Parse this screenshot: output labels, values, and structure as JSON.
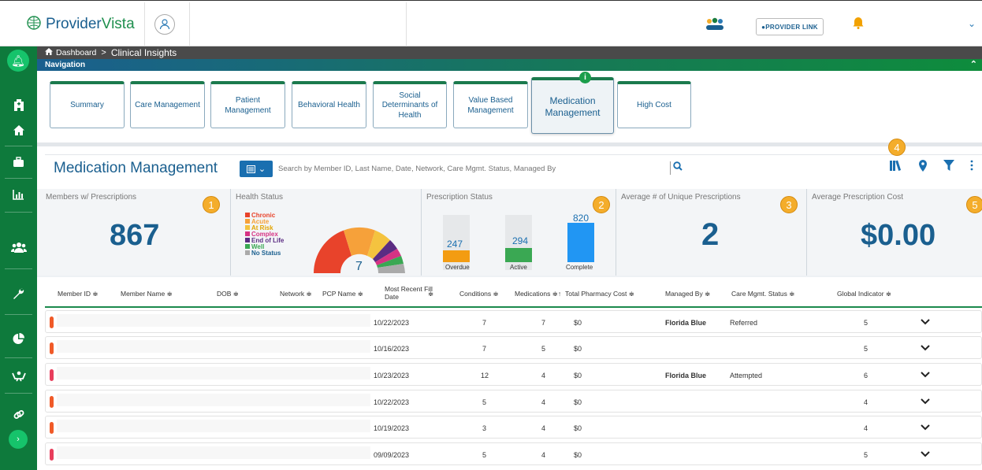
{
  "app": {
    "logo_text_a": "Provider",
    "logo_text_b": "Vista",
    "provider_link_label": "PROVIDER LINK"
  },
  "breadcrumb": {
    "home_icon": "home-icon",
    "root": "Dashboard",
    "sep": ">",
    "current": "Clinical Insights"
  },
  "navigation": {
    "label": "Navigation"
  },
  "tabs": [
    {
      "label": "Summary"
    },
    {
      "label": "Care Management"
    },
    {
      "label": "Patient Management"
    },
    {
      "label": "Behavioral Health"
    },
    {
      "label": "Social Determinants of Health"
    },
    {
      "label": "Value Based Management"
    },
    {
      "label": "Medication Management"
    },
    {
      "label": "High Cost"
    }
  ],
  "active_tab": "Medication Management",
  "page": {
    "title": "Medication Management",
    "search_placeholder": "Search by Member ID, Last Name, Date, Network, Care Mgmt. Status, Managed By"
  },
  "badges": [
    "1",
    "2",
    "3",
    "4",
    "5"
  ],
  "cards": {
    "members": {
      "title": "Members w/ Prescriptions",
      "value": "867"
    },
    "health": {
      "title": "Health Status",
      "legend": [
        {
          "label": "Chronic",
          "color": "#e8432b"
        },
        {
          "label": "Acute",
          "color": "#f6a13a"
        },
        {
          "label": "At Risk",
          "color": "#f4c33f"
        },
        {
          "label": "Complex",
          "color": "#d63384"
        },
        {
          "label": "End of Life",
          "color": "#5b2c83"
        },
        {
          "label": "Well",
          "color": "#3aa853"
        },
        {
          "label": "No Status",
          "color": "#aaaaaa"
        }
      ],
      "center_value": "7"
    },
    "prescription": {
      "title": "Prescription Status",
      "bars": [
        {
          "label": "Overdue",
          "value": "247",
          "color": "#f39c12"
        },
        {
          "label": "Active",
          "value": "294",
          "color": "#3aa853"
        },
        {
          "label": "Complete",
          "value": "820",
          "color": "#2196f3"
        }
      ]
    },
    "unique": {
      "title": "Average # of Unique Prescriptions",
      "value": "2"
    },
    "cost": {
      "title": "Average Prescription Cost",
      "value": "$0.00"
    }
  },
  "table": {
    "headers": {
      "member_id": "Member ID ≑",
      "member_name": "Member Name ≑",
      "dob": "DOB ≑",
      "network": "Network ≑",
      "pcp": "PCP Name ≑",
      "fill_date_a": "Most Recent Fill",
      "fill_date_b": "Date",
      "fill_sort": "≑",
      "conditions": "Conditions ≑",
      "medications": "Medications ≑↑",
      "cost": "Total Pharmacy Cost ≑",
      "managed_by": "Managed By ≑",
      "status": "Care Mgmt. Status ≑",
      "global": "Global Indicator ≑"
    },
    "rows": [
      {
        "fill_date": "10/22/2023",
        "conditions": "7",
        "medications": "7",
        "cost": "$0",
        "managed_by": "Florida Blue",
        "status": "Referred",
        "global": "5",
        "color": "#f05a28"
      },
      {
        "fill_date": "10/16/2023",
        "conditions": "7",
        "medications": "5",
        "cost": "$0",
        "managed_by": "",
        "status": "",
        "global": "5",
        "color": "#f05a28"
      },
      {
        "fill_date": "10/23/2023",
        "conditions": "12",
        "medications": "4",
        "cost": "$0",
        "managed_by": "Florida Blue",
        "status": "Attempted",
        "global": "6",
        "color": "#e83e5c"
      },
      {
        "fill_date": "10/22/2023",
        "conditions": "5",
        "medications": "4",
        "cost": "$0",
        "managed_by": "",
        "status": "",
        "global": "4",
        "color": "#f05a28"
      },
      {
        "fill_date": "10/19/2023",
        "conditions": "3",
        "medications": "4",
        "cost": "$0",
        "managed_by": "",
        "status": "",
        "global": "4",
        "color": "#f05a28"
      },
      {
        "fill_date": "09/09/2023",
        "conditions": "5",
        "medications": "4",
        "cost": "$0",
        "managed_by": "",
        "status": "",
        "global": "5",
        "color": "#e83e5c"
      }
    ]
  },
  "sidebar_icons": [
    "bell-icon",
    "hospital-icon",
    "home-icon",
    "briefcase-icon",
    "chart-icon",
    "users-icon",
    "wrench-icon",
    "pie-chart-icon",
    "hands-icon",
    "link-icon",
    "expand-icon"
  ]
}
